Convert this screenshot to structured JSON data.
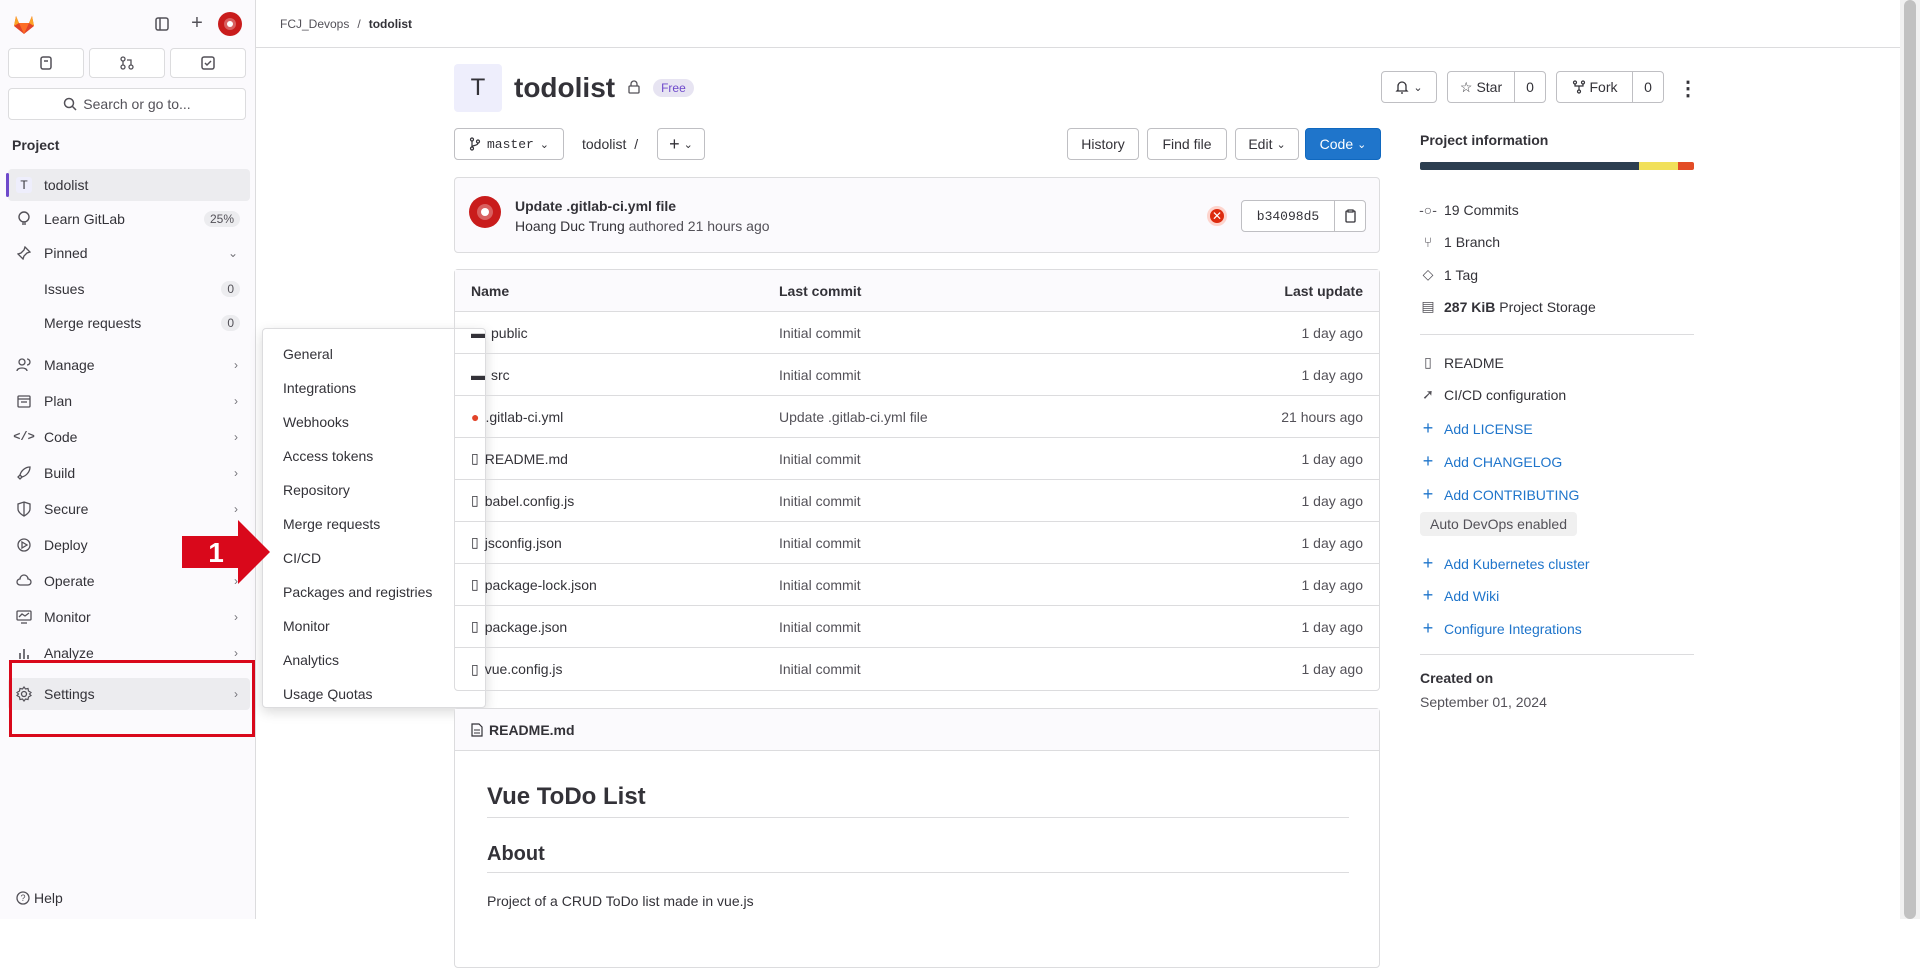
{
  "topbar": {
    "group": "FCJ_Devops",
    "separator": "/",
    "project": "todolist"
  },
  "sidebar": {
    "search_label": "Search or go to...",
    "section_title": "Project",
    "project_item": {
      "avatar_letter": "T",
      "label": "todolist"
    },
    "learn": {
      "label": "Learn GitLab",
      "badge": "25%"
    },
    "pinned": {
      "label": "Pinned"
    },
    "pinned_items": [
      {
        "label": "Issues",
        "badge": "0"
      },
      {
        "label": "Merge requests",
        "badge": "0"
      }
    ],
    "nav": [
      {
        "label": "Manage"
      },
      {
        "label": "Plan"
      },
      {
        "label": "Code"
      },
      {
        "label": "Build"
      },
      {
        "label": "Secure"
      },
      {
        "label": "Deploy"
      },
      {
        "label": "Operate"
      },
      {
        "label": "Monitor"
      },
      {
        "label": "Analyze"
      },
      {
        "label": "Settings"
      }
    ],
    "help": "Help"
  },
  "flyout": {
    "items": [
      "General",
      "Integrations",
      "Webhooks",
      "Access tokens",
      "Repository",
      "Merge requests",
      "CI/CD",
      "Packages and registries",
      "Monitor",
      "Analytics",
      "Usage Quotas"
    ]
  },
  "callout": {
    "number": "1",
    "color": "#d9081b"
  },
  "project": {
    "avatar_letter": "T",
    "name": "todolist",
    "tier": "Free",
    "star_label": "Star",
    "star_count": "0",
    "fork_label": "Fork",
    "fork_count": "0"
  },
  "repo_bar": {
    "branch": "master",
    "path": "todolist",
    "path_sep": "/",
    "history": "History",
    "find_file": "Find file",
    "edit": "Edit",
    "code": "Code"
  },
  "last_commit": {
    "title": "Update .gitlab-ci.yml file",
    "author": "Hoang Duc Trung",
    "meta": "authored 21 hours ago",
    "sha": "b34098d5"
  },
  "files": {
    "headers": {
      "name": "Name",
      "commit": "Last commit",
      "update": "Last update"
    },
    "rows": [
      {
        "name": "public",
        "type": "folder",
        "commit": "Initial commit",
        "update": "1 day ago"
      },
      {
        "name": "src",
        "type": "folder",
        "commit": "Initial commit",
        "update": "1 day ago"
      },
      {
        "name": ".gitlab-ci.yml",
        "type": "gitlab",
        "commit": "Update .gitlab-ci.yml file",
        "update": "21 hours ago"
      },
      {
        "name": "README.md",
        "type": "file",
        "commit": "Initial commit",
        "update": "1 day ago"
      },
      {
        "name": "babel.config.js",
        "type": "file",
        "commit": "Initial commit",
        "update": "1 day ago"
      },
      {
        "name": "jsconfig.json",
        "type": "file",
        "commit": "Initial commit",
        "update": "1 day ago"
      },
      {
        "name": "package-lock.json",
        "type": "file",
        "commit": "Initial commit",
        "update": "1 day ago"
      },
      {
        "name": "package.json",
        "type": "file",
        "commit": "Initial commit",
        "update": "1 day ago"
      },
      {
        "name": "vue.config.js",
        "type": "file",
        "commit": "Initial commit",
        "update": "1 day ago"
      }
    ]
  },
  "readme": {
    "filename": "README.md",
    "h1": "Vue ToDo List",
    "h2": "About",
    "p": "Project of a CRUD ToDo list made in vue.js"
  },
  "info": {
    "title": "Project information",
    "languages": [
      {
        "share": 0.8,
        "color": "#2c3e50"
      },
      {
        "share": 0.14,
        "color": "#f1e05a"
      },
      {
        "share": 0.06,
        "color": "#e34c26"
      }
    ],
    "stats": [
      {
        "count": "19",
        "label": "Commits",
        "icon": "commit-icon"
      },
      {
        "count": "1",
        "label": "Branch",
        "icon": "branch-icon"
      },
      {
        "count": "1",
        "label": "Tag",
        "icon": "tag-icon"
      },
      {
        "count": "287 KiB",
        "label": "Project Storage",
        "icon": "storage-icon"
      }
    ],
    "readme": "README",
    "cicd": "CI/CD configuration",
    "add_license": "Add LICENSE",
    "add_changelog": "Add CHANGELOG",
    "add_contributing": "Add CONTRIBUTING",
    "auto_devops": "Auto DevOps enabled",
    "add_k8s": "Add Kubernetes cluster",
    "add_wiki": "Add Wiki",
    "configure_integrations": "Configure Integrations",
    "created_label": "Created on",
    "created_date": "September 01, 2024"
  }
}
